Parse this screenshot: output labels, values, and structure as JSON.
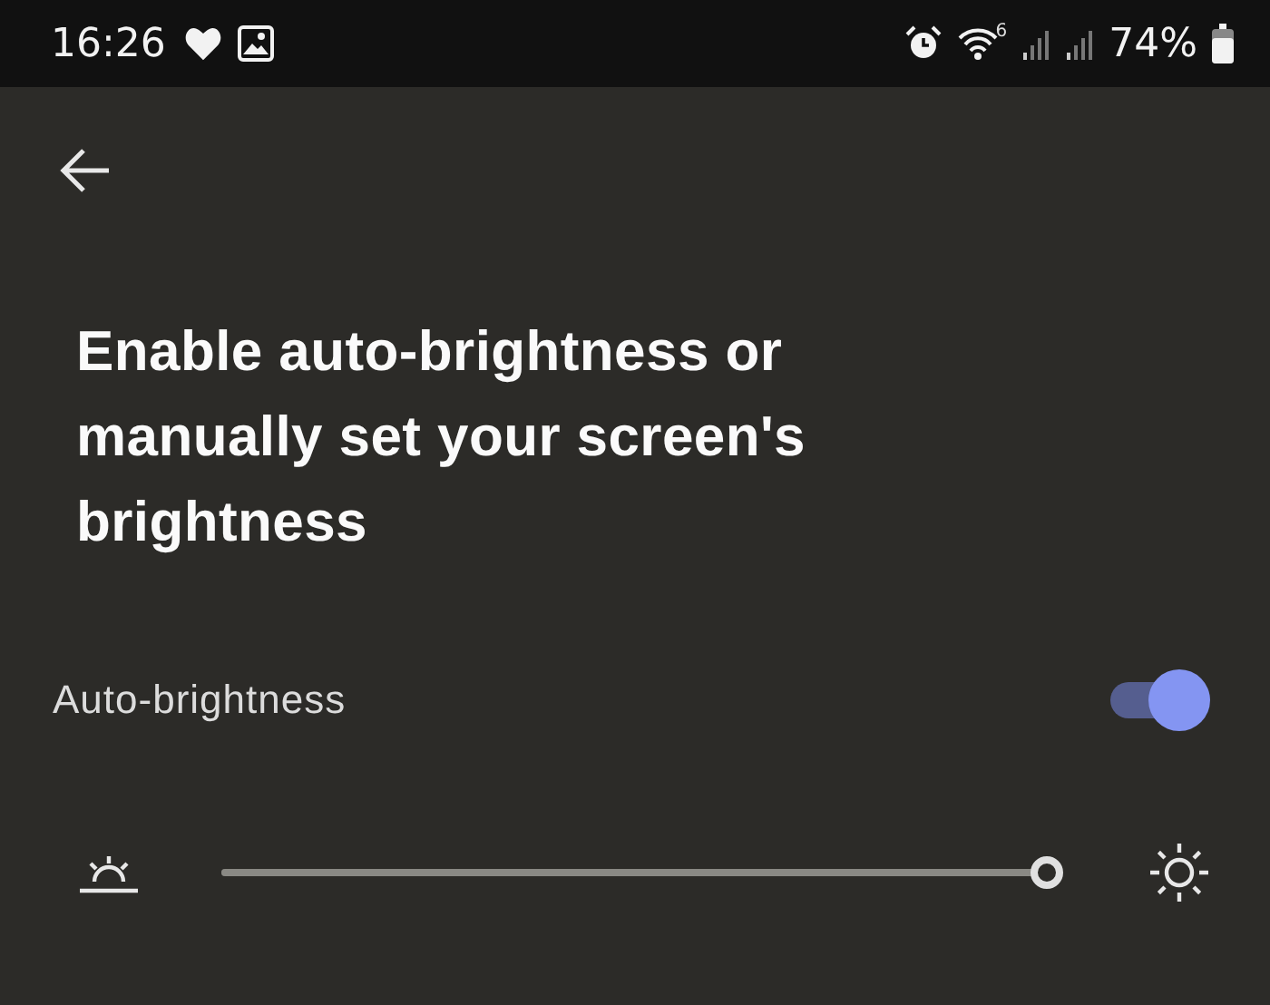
{
  "status_bar": {
    "time": "16:26",
    "wifi_label": "6",
    "battery": "74%"
  },
  "title": "Enable auto-brightness or manually set your screen's brightness",
  "auto_brightness": {
    "label": "Auto-brightness",
    "on": true
  },
  "brightness_slider": {
    "level": 1
  }
}
